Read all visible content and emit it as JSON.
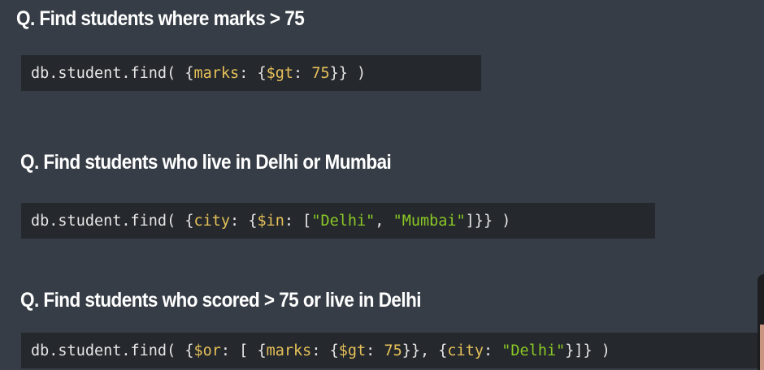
{
  "questions": [
    {
      "title": "Q. Find students where marks > 75",
      "code": {
        "prefix": "db.student.find( {",
        "key1": "marks",
        "p1": ": {",
        "op": "$gt",
        "p2": ": ",
        "num": "75",
        "suffix": "}} )"
      }
    },
    {
      "title": "Q. Find students who live in Delhi or Mumbai",
      "code": {
        "prefix": "db.student.find( {",
        "key1": "city",
        "p1": ": {",
        "op": "$in",
        "p2": ": [",
        "str1": "\"Delhi\"",
        "p3": ", ",
        "str2": "\"Mumbai\"",
        "suffix": "]}} )"
      }
    },
    {
      "title": "Q. Find students who scored > 75 or live in Delhi",
      "code": {
        "prefix": "db.student.find( {",
        "op_or": "$or",
        "p1": ": [ {",
        "key1": "marks",
        "p2": ": {",
        "op_gt": "$gt",
        "p3": ": ",
        "num": "75",
        "p4": "}}, {",
        "key2": "city",
        "p5": ": ",
        "str": "\"Delhi\"",
        "suffix": "}]} )"
      }
    }
  ],
  "colors": {
    "background": "#363d46",
    "code_background": "#25282c",
    "key": "#e6c15a",
    "string": "#8ac926",
    "text": "#e6e6e6"
  }
}
